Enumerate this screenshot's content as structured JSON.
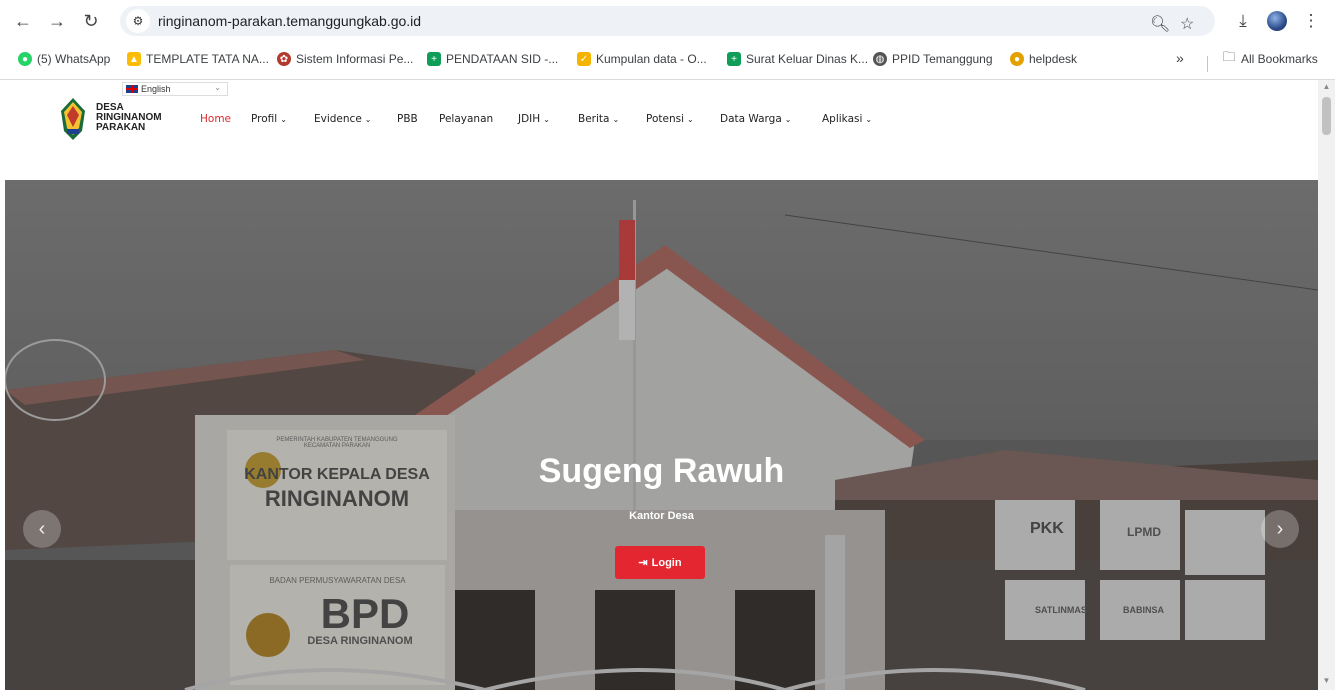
{
  "browser": {
    "url": "ringinanom-parakan.temanggungkab.go.id",
    "bookmarks": [
      {
        "label": "(5) WhatsApp",
        "icon": "whatsapp-icon",
        "color": "#25d366"
      },
      {
        "label": "TEMPLATE TATA NA...",
        "icon": "google-drive-icon",
        "color": "#fbbc04"
      },
      {
        "label": "Sistem Informasi Pe...",
        "icon": "institution-icon",
        "color": "#b23a2e"
      },
      {
        "label": "PENDATAAN SID -...",
        "icon": "sheets-icon",
        "color": "#0f9d58"
      },
      {
        "label": "Kumpulan data - O...",
        "icon": "sheets-icon",
        "color": "#f4b400"
      },
      {
        "label": "Surat Keluar Dinas K...",
        "icon": "sheets-icon",
        "color": "#0f9d58"
      },
      {
        "label": "PPID Temanggung",
        "icon": "globe-icon",
        "color": "#555555"
      },
      {
        "label": "helpdesk",
        "icon": "pin-icon",
        "color": "#e2a100"
      }
    ],
    "all_bookmarks": "All Bookmarks",
    "overflow": "»"
  },
  "site": {
    "language": "English",
    "brand_lines": [
      "DESA",
      "RINGINANOM",
      "PARAKAN"
    ],
    "nav": [
      {
        "label": "Home",
        "active": true,
        "dropdown": false
      },
      {
        "label": "Profil",
        "dropdown": true
      },
      {
        "label": "Evidence",
        "dropdown": true
      },
      {
        "label": "PBB",
        "dropdown": false
      },
      {
        "label": "Pelayanan",
        "dropdown": false
      },
      {
        "label": "JDIH",
        "dropdown": true
      },
      {
        "label": "Berita",
        "dropdown": true
      },
      {
        "label": "Potensi",
        "dropdown": true
      },
      {
        "label": "Data Warga",
        "dropdown": true
      },
      {
        "label": "Aplikasi",
        "dropdown": true
      }
    ],
    "accent": "#e3262f"
  },
  "hero": {
    "title": "Sugeng Rawuh",
    "subtitle": "Kantor Desa",
    "login_label": "Login",
    "sign_texts": {
      "office_top": "PEMERINTAH KABUPATEN TEMANGGUNG",
      "office_sub": "KECAMATAN PARAKAN",
      "office_name1": "KANTOR KEPALA DESA",
      "office_name2": "RINGINANOM",
      "bpd_top": "BADAN PERMUSYAWARATAN DESA",
      "bpd": "BPD",
      "bpd_sub": "DESA RINGINANOM",
      "pkk": "PKK",
      "lpmd": "LPMD",
      "satlinmas": "SATLINMAS",
      "babinsa": "BABINSA"
    }
  }
}
